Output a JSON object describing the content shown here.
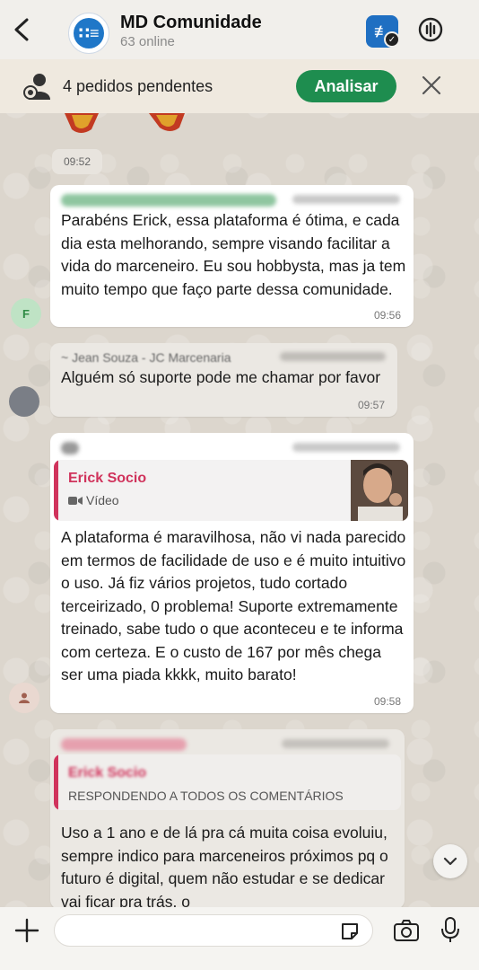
{
  "header": {
    "title": "MD Comunidade",
    "subtitle": "63 online",
    "group_logo": "∷≡"
  },
  "pending": {
    "label": "4 pedidos pendentes",
    "button": "Analisar"
  },
  "messages": [
    {
      "time": "09:52"
    },
    {
      "avatar_letter": "F",
      "text": "Parabéns Erick, essa plataforma é ótima, e cada dia esta melhorando, sempre visando facilitar a vida do marceneiro. Eu sou hobbysta, mas ja tem muito tempo que faço parte dessa comunidade.",
      "time": "09:56"
    },
    {
      "sender": "~ Jean Souza - JC Marcenaria",
      "text": "Alguém só suporte pode me chamar por favor",
      "time": "09:57"
    },
    {
      "quote_name": "Erick Socio",
      "quote_type": "Vídeo",
      "text": "A plataforma é maravilhosa, não vi nada parecido em termos de facilidade de uso e é muito intuitivo o uso. Já fiz vários projetos, tudo cortado terceirizado, 0 problema! Suporte extremamente treinado, sabe tudo o que aconteceu e te informa com certeza. E o custo de 167 por mês chega ser uma piada kkkk, muito barato!",
      "time": "09:58"
    },
    {
      "quote_name": "Erick Socio",
      "quote_type": "RESPONDENDO A TODOS OS COMENTÁRIOS",
      "text": "Uso a 1 ano e de lá pra cá muita coisa evoluiu, sempre indico para marceneiros próximos pq o futuro é digital, quem não estudar e se dedicar vai ficar pra trás. o"
    }
  ],
  "colors": {
    "accent_green": "#1e8d4f",
    "quote_red": "#d0335c",
    "brand_blue": "#1f77c8"
  },
  "icons": [
    "back-icon",
    "voice-chat-icon",
    "people-icon",
    "close-icon",
    "plus-icon",
    "sticker-icon",
    "camera-icon",
    "mic-icon",
    "chevron-down-icon",
    "video-icon"
  ]
}
